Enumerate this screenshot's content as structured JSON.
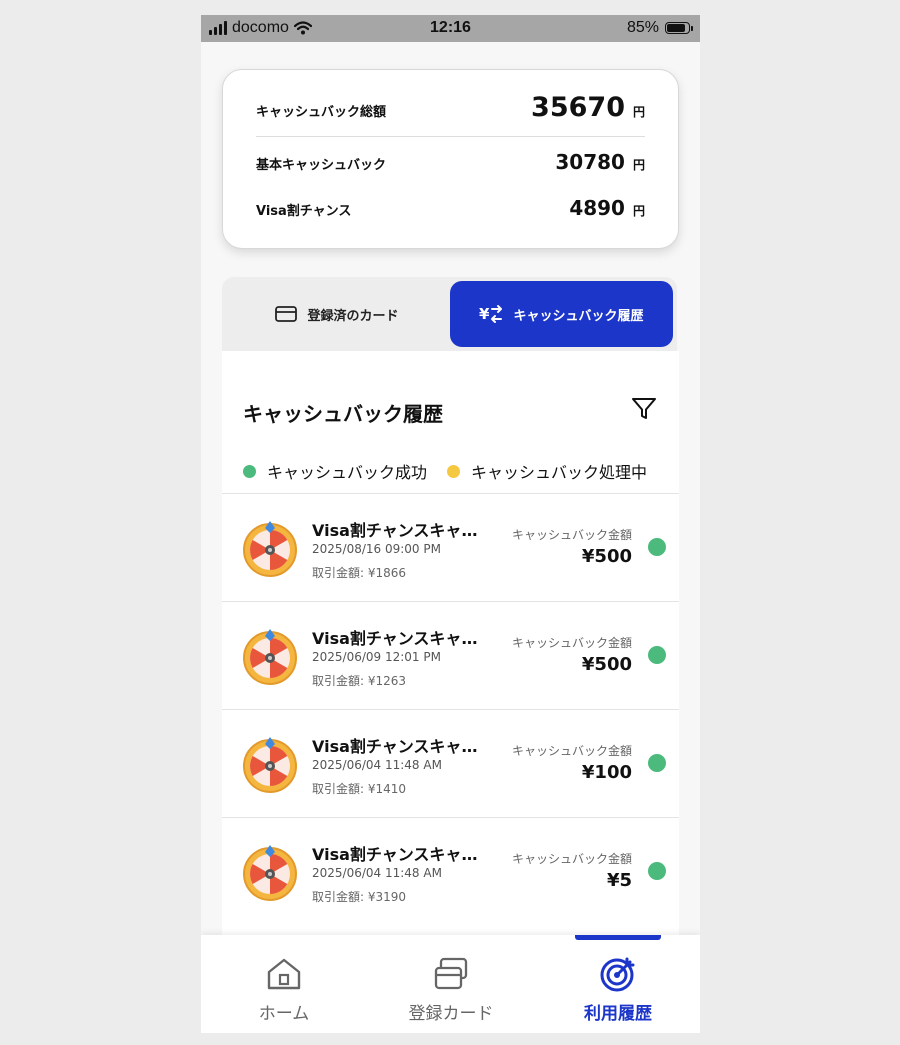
{
  "status_bar": {
    "carrier": "docomo",
    "time": "12:16",
    "battery": "85%"
  },
  "summary": {
    "total_label": "キャッシュバック総額",
    "total_value": "35670",
    "total_unit": "円",
    "basic_label": "基本キャッシュバック",
    "basic_value": "30780",
    "basic_unit": "円",
    "visa_label": "Visa割チャンス",
    "visa_value": "4890",
    "visa_unit": "円"
  },
  "tabs": {
    "cards_label": "登録済のカード",
    "history_label": "キャッシュバック履歴",
    "active": "history"
  },
  "history": {
    "title": "キャッシュバック履歴",
    "legend": {
      "success": "キャッシュバック成功",
      "processing": "キャッシュバック処理中"
    },
    "colors": {
      "success": "#4cba7c",
      "processing": "#f5c842",
      "accent": "#1c36c9"
    },
    "items": [
      {
        "name": "Visa割チャンスキャッシュバック",
        "date": "2025/08/16 09:00 PM",
        "amount": "取引金額: ¥1866",
        "cb_label": "キャッシュバック金額",
        "cb_value": "¥500",
        "status": "success"
      },
      {
        "name": "Visa割チャンスキャッシュバック",
        "date": "2025/06/09 12:01 PM",
        "amount": "取引金額: ¥1263",
        "cb_label": "キャッシュバック金額",
        "cb_value": "¥500",
        "status": "success"
      },
      {
        "name": "Visa割チャンスキャッシュバック",
        "date": "2025/06/04 11:48 AM",
        "amount": "取引金額: ¥1410",
        "cb_label": "キャッシュバック金額",
        "cb_value": "¥100",
        "status": "success"
      },
      {
        "name": "Visa割チャンスキャッシュバック",
        "date": "2025/06/04 11:48 AM",
        "amount": "取引金額: ¥3190",
        "cb_label": "キャッシュバック金額",
        "cb_value": "¥5",
        "status": "success"
      }
    ]
  },
  "tabbar": {
    "home": "ホーム",
    "cards": "登録カード",
    "history": "利用履歴",
    "active": "history"
  }
}
